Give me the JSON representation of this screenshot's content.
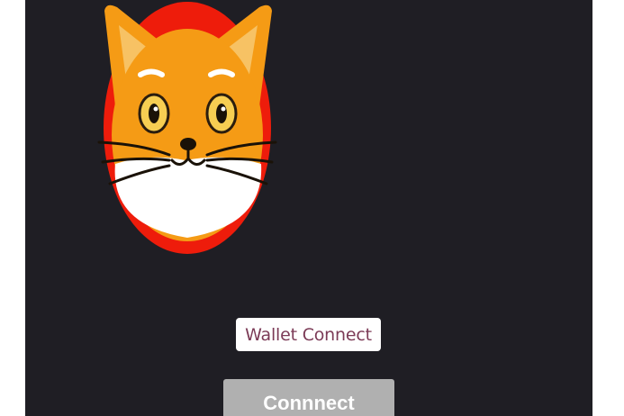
{
  "app": {
    "background_color": "#1f1e24",
    "logo": {
      "icon": "cat-face-icon",
      "ring_color": "#ee1c0b",
      "fur_color": "#f59b15"
    }
  },
  "actions": {
    "wallet_connect_label": "Wallet Connect",
    "connect_label": "Connnect"
  }
}
